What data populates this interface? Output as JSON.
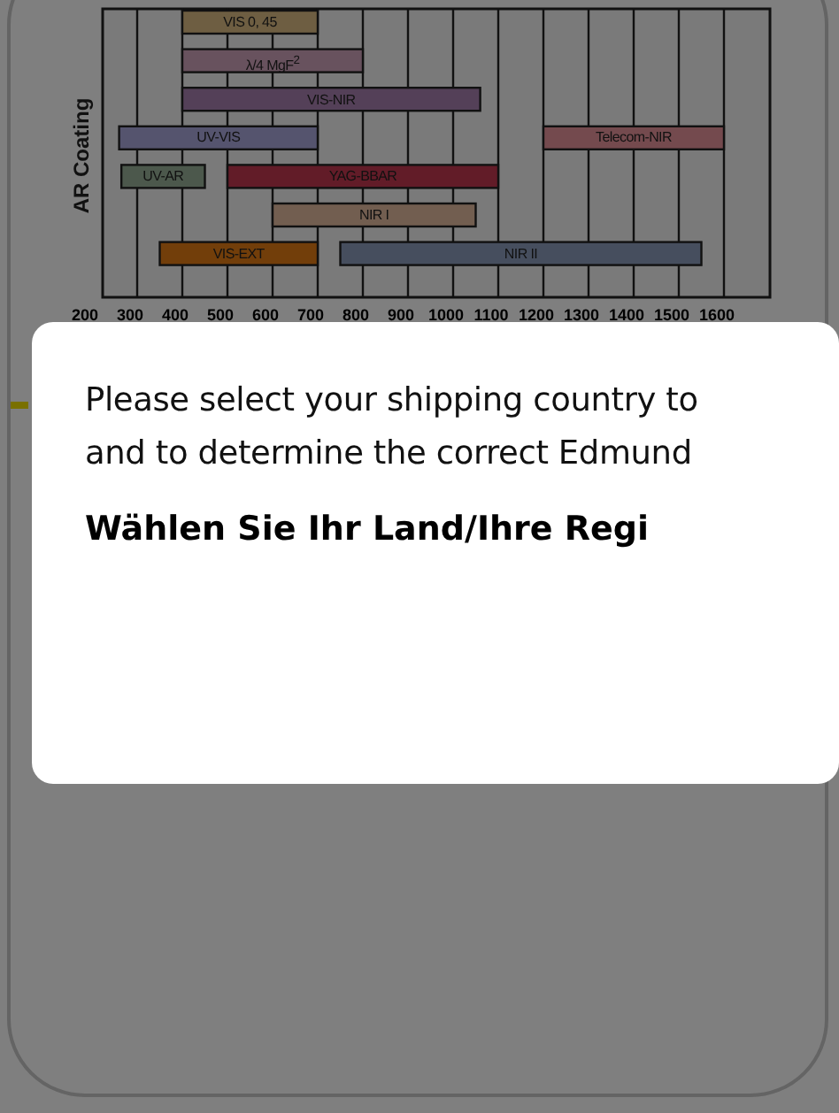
{
  "coating_chart": {
    "ylabel": "AR Coating",
    "xticks": [
      "200",
      "300",
      "400",
      "500",
      "600",
      "700",
      "800",
      "900",
      "1000",
      "1100",
      "1200",
      "1300",
      "1400",
      "1500",
      "1600"
    ],
    "rows": [
      {
        "bars": [
          {
            "label": "VIS 0, 45",
            "color": "#6e5e42"
          }
        ]
      },
      {
        "bars": [
          {
            "label": "λ/4 MgF$^{2}$",
            "color": "#68525e"
          }
        ]
      },
      {
        "bars": [
          {
            "label": "VIS-NIR",
            "color": "#544058"
          }
        ]
      },
      {
        "bars": [
          {
            "label": "UV-VIS",
            "color": "#55546e"
          },
          {
            "label": "Telecom-NIR",
            "color": "#744a4e"
          }
        ]
      },
      {
        "bars": [
          {
            "label": "UV-AR",
            "color": "#4c584c"
          },
          {
            "label": "YAG-BBAR",
            "color": "#621c28"
          }
        ]
      },
      {
        "bars": [
          {
            "label": "NIR I",
            "color": "#725e50"
          }
        ]
      },
      {
        "bars": [
          {
            "label": "VIS-EXT",
            "color": "#723e0a"
          },
          {
            "label": "NIR II",
            "color": "#464e5e"
          }
        ]
      }
    ]
  },
  "dialog": {
    "message": "Please select your shipping country to",
    "message_line_2": "and to determine the correct Edmund",
    "heading": "Wählen Sie Ihr Land/Ihre Regi"
  }
}
